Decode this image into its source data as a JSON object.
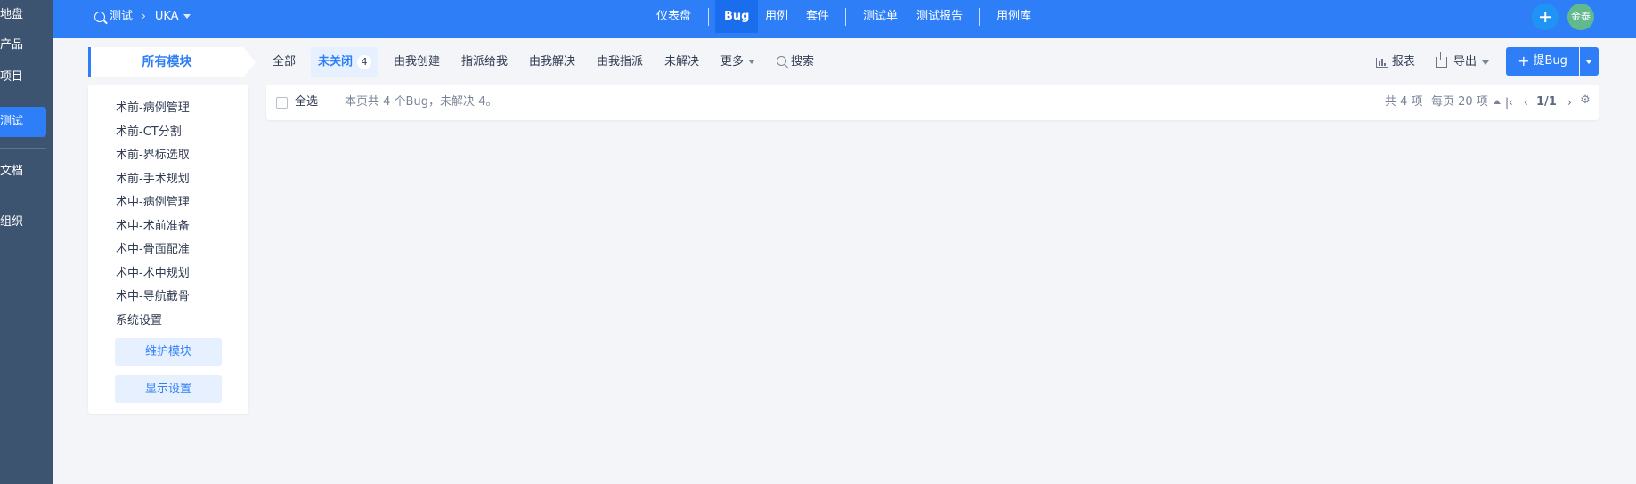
{
  "leftnav": {
    "items": [
      {
        "label": "地盘"
      },
      {
        "label": "产品"
      },
      {
        "label": "项目"
      },
      {
        "label": "测试"
      },
      {
        "label": "文档"
      },
      {
        "label": "组织"
      }
    ]
  },
  "topbar": {
    "crumb_app": "测试",
    "crumb_product": "UKA",
    "nav": [
      "仪表盘",
      "Bug",
      "用例",
      "套件",
      "测试单",
      "测试报告",
      "用例库"
    ],
    "avatar_text": "金泰"
  },
  "modules": {
    "header": "所有模块",
    "items": [
      "术前-病例管理",
      "术前-CT分割",
      "术前-界标选取",
      "术前-手术规划",
      "术中-病例管理",
      "术中-术前准备",
      "术中-骨面配准",
      "术中-术中规划",
      "术中-导航截骨",
      "系统设置"
    ],
    "maintain_button": "维护模块",
    "display_button": "显示设置"
  },
  "filters": {
    "all": "全部",
    "unclosed": "未关闭",
    "unclosed_count": "4",
    "created_by_me": "由我创建",
    "assigned_to_me": "指派给我",
    "resolved_by_me": "由我解决",
    "assigned_by_me": "由我指派",
    "unresolved": "未解决",
    "more": "更多",
    "search": "搜索"
  },
  "toolbar": {
    "report": "报表",
    "export": "导出",
    "create_bug": "提Bug"
  },
  "table": {
    "select_all": "全选",
    "summary": "本页共 4 个Bug，未解决 4。",
    "total": "共 4 项",
    "per_page": "每页 20 项",
    "page": "1/1"
  },
  "colors": {
    "primary": "#2e7ff7",
    "sidebar": "#3d5470",
    "background": "#f3f5f8"
  }
}
